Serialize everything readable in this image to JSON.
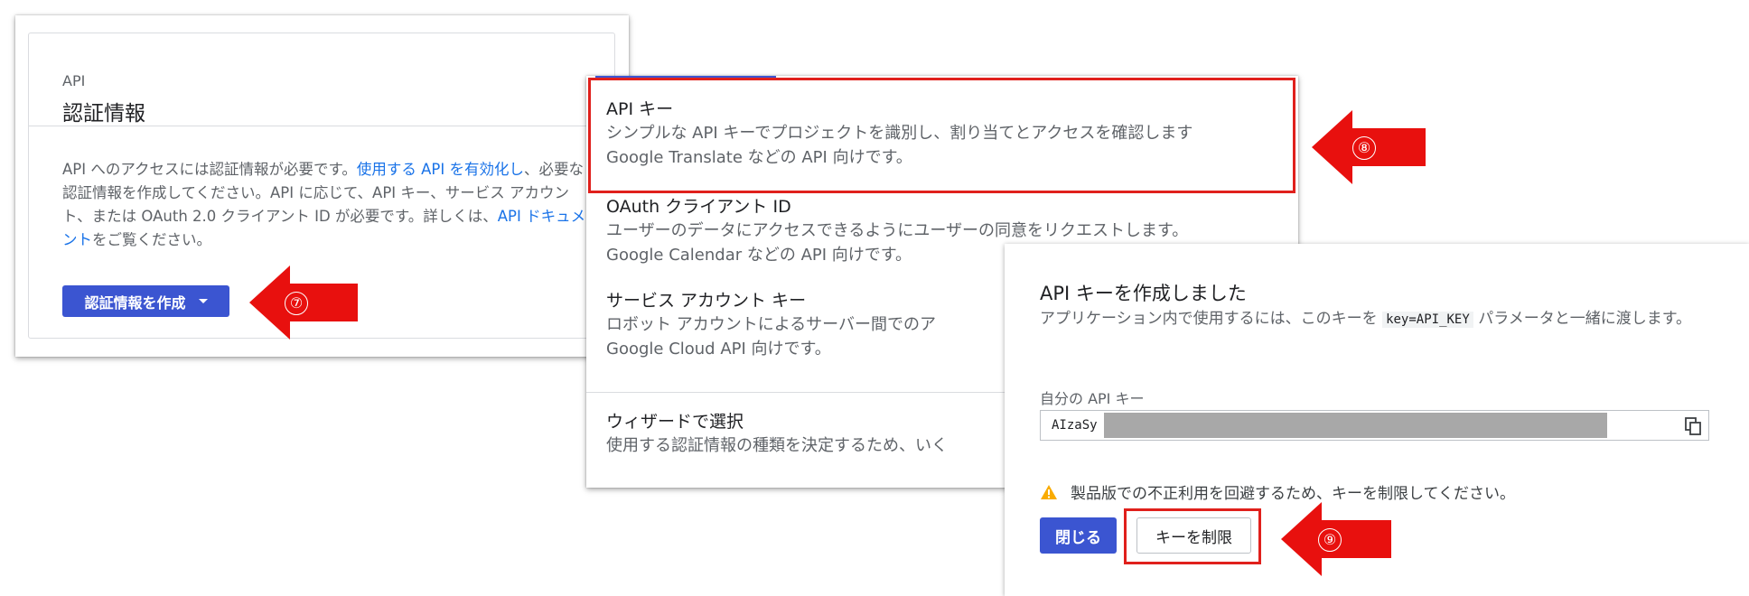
{
  "credentials_panel": {
    "eyebrow": "API",
    "title": "認証情報",
    "body_part1": "API へのアクセスには認証情報が必要です。",
    "body_link1": "使用する API を有効化し",
    "body_part2": "、必要な認証情報を作成してください。API に応じて、API キー、サービス アカウント、または OAuth 2.0 クライアント ID が必要です。詳しくは、",
    "body_link2": "API ドキュメント",
    "body_part3": "をご覧ください。",
    "create_button_label": "認証情報を作成"
  },
  "callouts": {
    "step7": "⑦",
    "step8": "⑧",
    "step9": "⑨"
  },
  "create_menu": {
    "items": [
      {
        "title": "API キー",
        "desc1": "シンプルな API キーでプロジェクトを識別し、割り当てとアクセスを確認します",
        "desc2": "Google Translate などの API 向けです。"
      },
      {
        "title": "OAuth クライアント ID",
        "desc1": "ユーザーのデータにアクセスできるようにユーザーの同意をリクエストします。",
        "desc2": "Google Calendar などの API 向けです。"
      },
      {
        "title": "サービス アカウント キー",
        "desc1": "ロボット アカウントによるサーバー間でのア",
        "desc2": "Google Cloud API 向けです。"
      },
      {
        "title": "ウィザードで選択",
        "desc1": "使用する認証情報の種類を決定するため、いく"
      }
    ]
  },
  "created_dialog": {
    "title": "API キーを作成しました",
    "desc_part1": "アプリケーション内で使用するには、このキーを ",
    "desc_code": "key=API_KEY",
    "desc_part2": " パラメータと一緒に渡します。",
    "key_label": "自分の API キー",
    "key_value": "AIzaSy",
    "warning_text": "製品版での不正利用を回避するため、キーを制限してください。",
    "close_button_label": "閉じる",
    "restrict_button_label": "キーを制限"
  },
  "colors": {
    "primary_blue": "#3b55d1",
    "link_blue": "#1a73e8",
    "callout_red": "#e8100e",
    "warning_yellow": "#f9ab00"
  },
  "icons": [
    "caret-down-icon",
    "copy-icon",
    "warning-icon"
  ]
}
